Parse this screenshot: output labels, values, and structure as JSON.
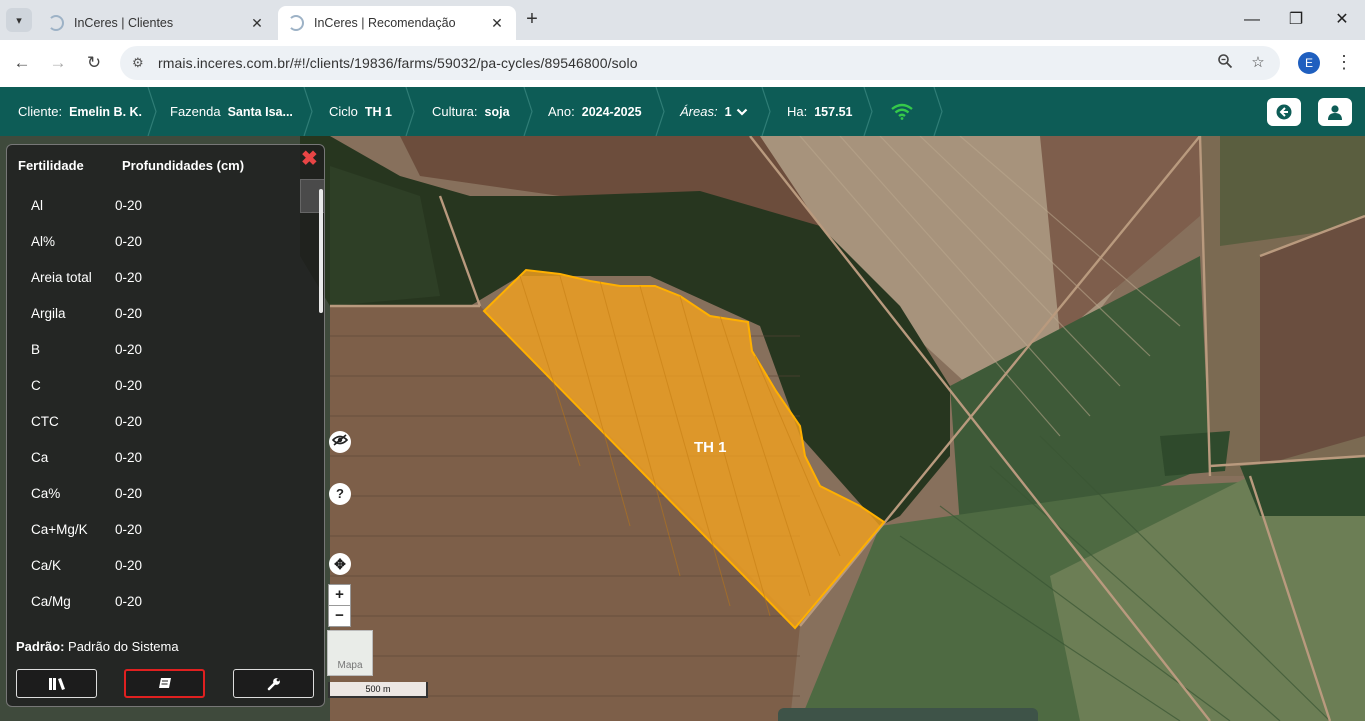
{
  "browser": {
    "tabs": [
      {
        "title": "InCeres | Clientes",
        "active": false
      },
      {
        "title": "InCeres | Recomendação",
        "active": true
      }
    ],
    "url": "rmais.inceres.com.br/#!/clients/19836/farms/59032/pa-cycles/89546800/solo",
    "profile_initial": "E"
  },
  "header": {
    "cliente_label": "Cliente:",
    "cliente_value": "Emelin B. K.",
    "fazenda_label": "Fazenda",
    "fazenda_value": "Santa Isa...",
    "ciclo_label": "Ciclo",
    "ciclo_value": "TH 1",
    "cultura_label": "Cultura:",
    "cultura_value": "soja",
    "ano_label": "Ano:",
    "ano_value": "2024-2025",
    "areas_label": "Áreas:",
    "areas_value": "1",
    "ha_label": "Ha:",
    "ha_value": "157.51"
  },
  "map": {
    "field_name": "TH 1",
    "field_color": "#f0a020",
    "layer_toggle_label": "Mapa",
    "scale_label": "500 m",
    "zoom_in": "+",
    "zoom_out": "−"
  },
  "panel": {
    "col_fertility": "Fertilidade",
    "col_depth": "Profundidades (cm)",
    "rows": [
      {
        "param": "Al",
        "depth": "0-20"
      },
      {
        "param": "Al%",
        "depth": "0-20"
      },
      {
        "param": "Areia total",
        "depth": "0-20"
      },
      {
        "param": "Argila",
        "depth": "0-20"
      },
      {
        "param": "B",
        "depth": "0-20"
      },
      {
        "param": "C",
        "depth": "0-20"
      },
      {
        "param": "CTC",
        "depth": "0-20"
      },
      {
        "param": "Ca",
        "depth": "0-20"
      },
      {
        "param": "Ca%",
        "depth": "0-20"
      },
      {
        "param": "Ca+Mg/K",
        "depth": "0-20"
      },
      {
        "param": "Ca/K",
        "depth": "0-20"
      },
      {
        "param": "Ca/Mg",
        "depth": "0-20"
      }
    ],
    "default_label": "Padrão:",
    "default_value": "Padrão do Sistema"
  }
}
